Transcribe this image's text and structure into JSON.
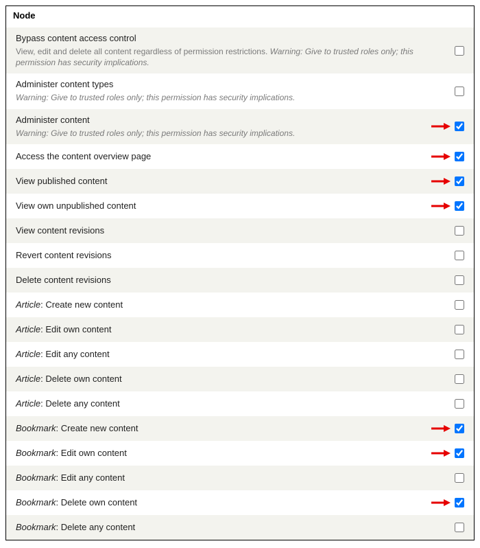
{
  "section_title": "Node",
  "arrow_color": "#e60000",
  "permissions": [
    {
      "title": "Bypass content access control",
      "desc_prefix": "View, edit and delete all content regardless of permission restrictions. ",
      "warning": "Warning: Give to trusted roles only; this permission has security implications.",
      "checked": false,
      "arrow": false
    },
    {
      "title": "Administer content types",
      "desc_prefix": "",
      "warning": "Warning: Give to trusted roles only; this permission has security implications.",
      "checked": false,
      "arrow": false
    },
    {
      "title": "Administer content",
      "desc_prefix": "",
      "warning": "Warning: Give to trusted roles only; this permission has security implications.",
      "checked": true,
      "arrow": true
    },
    {
      "title": "Access the content overview page",
      "checked": true,
      "arrow": true
    },
    {
      "title": "View published content",
      "checked": true,
      "arrow": true
    },
    {
      "title": "View own unpublished content",
      "checked": true,
      "arrow": true
    },
    {
      "title": "View content revisions",
      "checked": false,
      "arrow": false
    },
    {
      "title": "Revert content revisions",
      "checked": false,
      "arrow": false
    },
    {
      "title": "Delete content revisions",
      "checked": false,
      "arrow": false
    },
    {
      "type_prefix": "Article",
      "title_rest": ": Create new content",
      "checked": false,
      "arrow": false
    },
    {
      "type_prefix": "Article",
      "title_rest": ": Edit own content",
      "checked": false,
      "arrow": false
    },
    {
      "type_prefix": "Article",
      "title_rest": ": Edit any content",
      "checked": false,
      "arrow": false
    },
    {
      "type_prefix": "Article",
      "title_rest": ": Delete own content",
      "checked": false,
      "arrow": false
    },
    {
      "type_prefix": "Article",
      "title_rest": ": Delete any content",
      "checked": false,
      "arrow": false
    },
    {
      "type_prefix": "Bookmark",
      "title_rest": ": Create new content",
      "checked": true,
      "arrow": true
    },
    {
      "type_prefix": "Bookmark",
      "title_rest": ": Edit own content",
      "checked": true,
      "arrow": true
    },
    {
      "type_prefix": "Bookmark",
      "title_rest": ": Edit any content",
      "checked": false,
      "arrow": false
    },
    {
      "type_prefix": "Bookmark",
      "title_rest": ": Delete own content",
      "checked": true,
      "arrow": true
    },
    {
      "type_prefix": "Bookmark",
      "title_rest": ": Delete any content",
      "checked": false,
      "arrow": false
    }
  ]
}
